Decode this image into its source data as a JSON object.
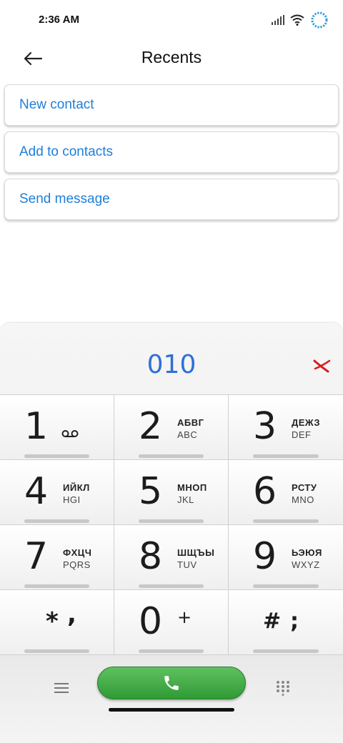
{
  "status_bar": {
    "time": "2:36 AM"
  },
  "header": {
    "title": "Recents"
  },
  "actions": [
    {
      "label": "New contact"
    },
    {
      "label": "Add to contacts"
    },
    {
      "label": "Send message"
    }
  ],
  "dialer": {
    "number": "010",
    "keys": [
      {
        "digit": "1",
        "cyr": "",
        "lat": ""
      },
      {
        "digit": "2",
        "cyr": "АБВГ",
        "lat": "ABC"
      },
      {
        "digit": "3",
        "cyr": "ДЕЖЗ",
        "lat": "DEF"
      },
      {
        "digit": "4",
        "cyr": "ИЙКЛ",
        "lat": "HGI"
      },
      {
        "digit": "5",
        "cyr": "МНОП",
        "lat": "JKL"
      },
      {
        "digit": "6",
        "cyr": "РСТУ",
        "lat": "MNO"
      },
      {
        "digit": "7",
        "cyr": "ФХЦЧ",
        "lat": "PQRS"
      },
      {
        "digit": "8",
        "cyr": "ШЩЪЫ",
        "lat": "TUV"
      },
      {
        "digit": "9",
        "cyr": "ЬЭЮЯ",
        "lat": "WXYZ"
      },
      {
        "digit": "*",
        "extra": ","
      },
      {
        "digit": "0",
        "extra": "+"
      },
      {
        "digit": "#",
        "extra": ";"
      }
    ]
  },
  "icons": {
    "back": "arrow-left-icon",
    "clear": "backspace-x-icon",
    "voicemail": "voicemail-icon",
    "menu": "hamburger-menu-icon",
    "call": "phone-icon",
    "dialpad": "dialpad-grid-icon"
  },
  "colors": {
    "link": "#1e7fd8",
    "number": "#2f6fd6",
    "call_green": "#3aa83f",
    "clear_red": "#d81b1b",
    "loading_blue": "#2a9bd8"
  }
}
